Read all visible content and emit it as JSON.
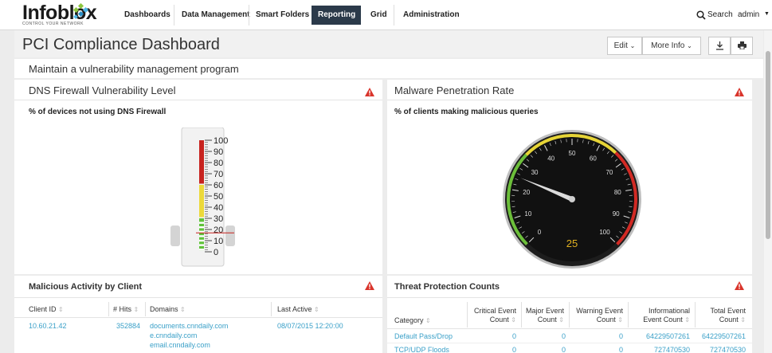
{
  "logo": {
    "brand": "Infoblox",
    "tagline": "CONTROL YOUR NETWORK"
  },
  "nav": {
    "tabs": [
      "Dashboards",
      "Data Management",
      "Smart Folders",
      "Reporting",
      "Grid",
      "Administration"
    ],
    "active": "Reporting",
    "search_label": "Search",
    "user": "admin"
  },
  "page": {
    "title": "PCI Compliance Dashboard",
    "edit_label": "Edit",
    "more_info_label": "More Info",
    "section_title": "Maintain a vulnerability management program"
  },
  "dns_panel": {
    "title": "DNS Firewall Vulnerability Level",
    "subtitle": "% of devices not using DNS Firewall",
    "thermometer_value": 17,
    "ticks": [
      "100",
      "90",
      "80",
      "70",
      "60",
      "50",
      "40",
      "30",
      "20",
      "10",
      "0"
    ]
  },
  "malware_panel": {
    "title": "Malware Penetration Rate",
    "subtitle": "% of clients making malicious queries",
    "gauge_value": "25",
    "gauge_ticks": [
      "0",
      "10",
      "20",
      "30",
      "40",
      "50",
      "60",
      "70",
      "80",
      "90",
      "100"
    ]
  },
  "activity_panel": {
    "title": "Malicious Activity by Client",
    "headers": [
      "Client ID",
      "# Hits",
      "Domains",
      "Last Active"
    ],
    "row": {
      "client_id": "10.60.21.42",
      "hits": "352884",
      "domains": [
        "documents.cnndaily.com",
        "e.cnndaily.com",
        "email.cnndaily.com"
      ],
      "last_active": "08/07/2015 12:20:00"
    }
  },
  "threat_panel": {
    "title": "Threat Protection Counts",
    "headers": [
      "Category",
      "Critical Event Count",
      "Major Event Count",
      "Warning Event Count",
      "Informational Event Count",
      "Total Event Count"
    ],
    "rows": [
      {
        "category": "Default Pass/Drop",
        "critical": "0",
        "major": "0",
        "warning": "0",
        "info": "64229507261",
        "total": "64229507261"
      },
      {
        "category": "TCP/UDP Floods",
        "critical": "0",
        "major": "0",
        "warning": "0",
        "info": "727470530",
        "total": "727470530"
      }
    ]
  },
  "colors": {
    "nav_active": "#2b3a4a",
    "link": "#3aa0c8",
    "warn": "#d9342b",
    "gauge_value": "#e0b020"
  }
}
